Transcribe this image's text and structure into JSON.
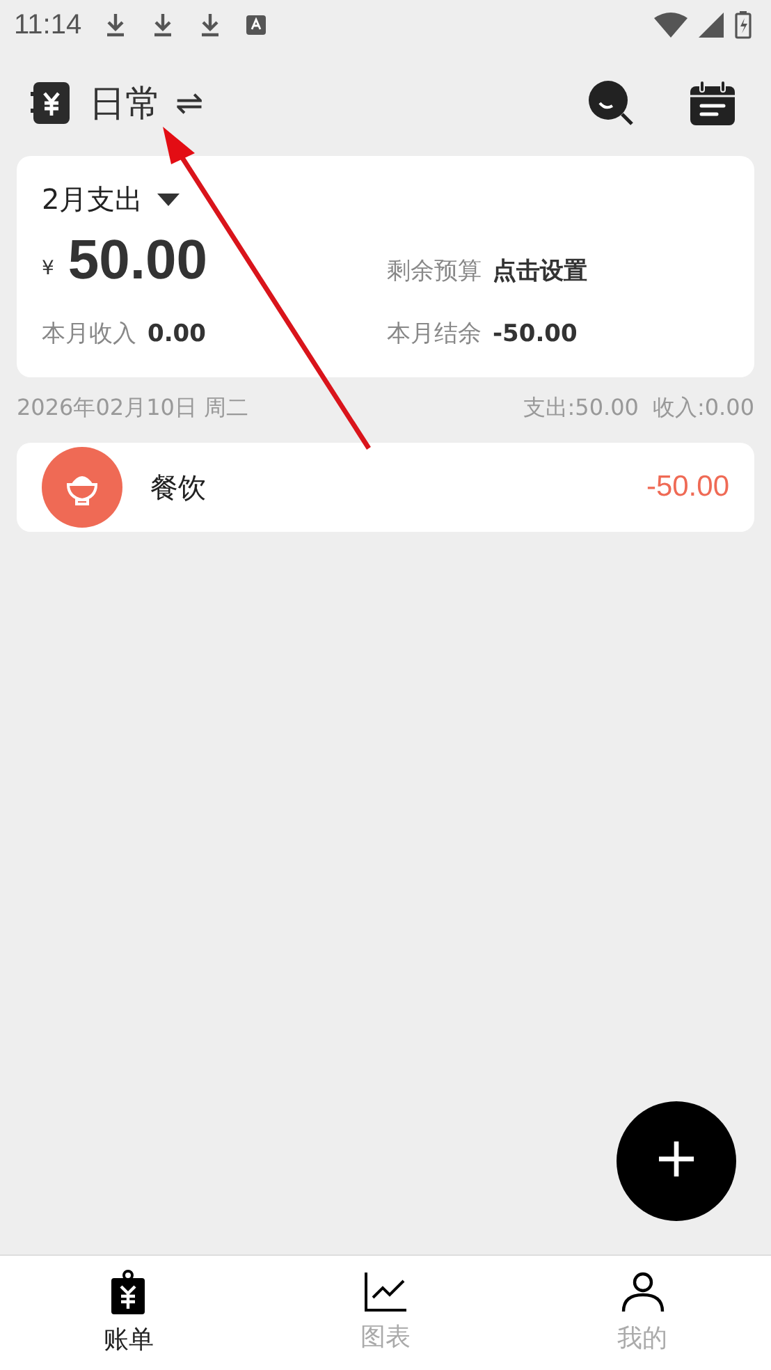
{
  "status_bar": {
    "time": "11:14"
  },
  "header": {
    "title": "日常",
    "switch_symbol": "⇌"
  },
  "summary": {
    "period": "2月支出",
    "currency": "¥",
    "amount": "50.00",
    "income_label": "本月收入",
    "income": "0.00",
    "budget_label": "剩余预算",
    "budget": "点击设置",
    "balance_label": "本月结余",
    "balance": "-50.00"
  },
  "day": {
    "date": "2026年02月10日 周二",
    "expense": "支出:50.00",
    "income": "收入:0.00"
  },
  "entries": [
    {
      "category": "餐饮",
      "amount": "-50.00",
      "color": "#ef6a55"
    }
  ],
  "fab": {
    "symbol": "+"
  },
  "tabs": [
    {
      "label": "账单",
      "kind": "bill",
      "selected": true
    },
    {
      "label": "图表",
      "kind": "chart",
      "selected": false
    },
    {
      "label": "我的",
      "kind": "profile",
      "selected": false
    }
  ]
}
